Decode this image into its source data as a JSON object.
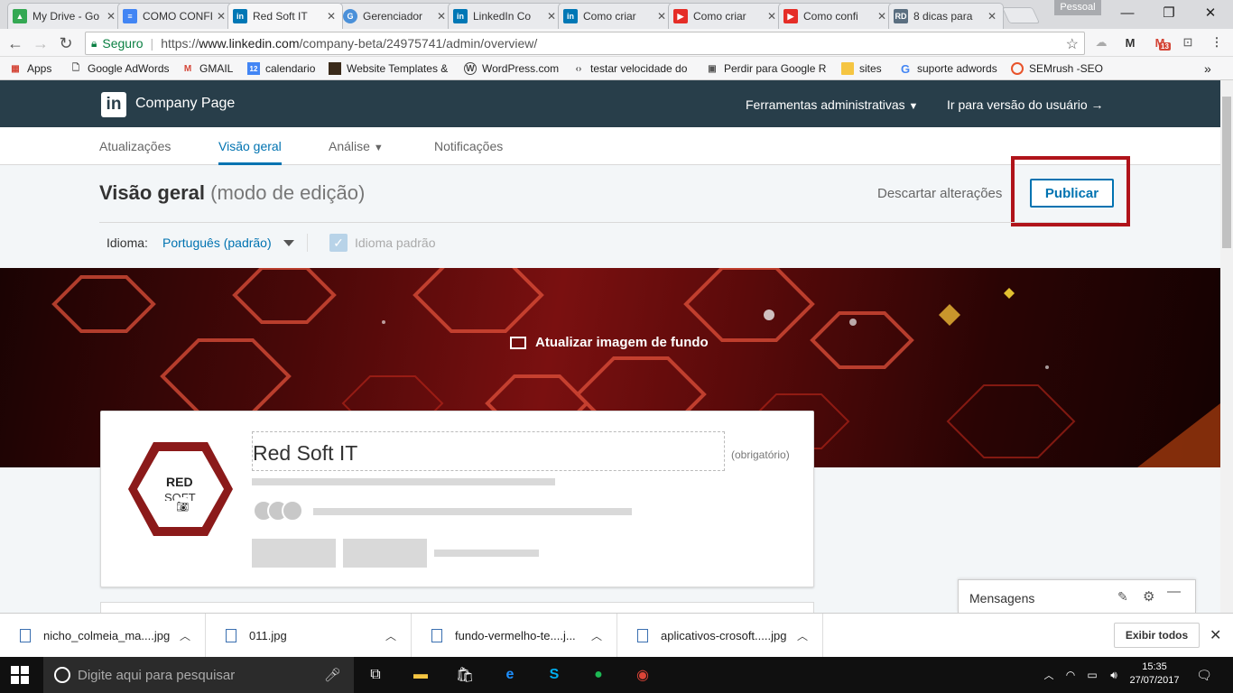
{
  "browser": {
    "tabs": [
      {
        "title": "My Drive - Go",
        "favicon": "google-drive-icon",
        "color": "#34a853"
      },
      {
        "title": "COMO CONFI",
        "favicon": "google-docs-icon",
        "color": "#4285f4"
      },
      {
        "title": "Red Soft IT",
        "favicon": "linkedin-icon",
        "color": "#0077b5",
        "active": true
      },
      {
        "title": "Gerenciador",
        "favicon": "gerenciador-icon",
        "color": "#4a90d9"
      },
      {
        "title": "LinkedIn Co",
        "favicon": "linkedin-icon",
        "color": "#0077b5"
      },
      {
        "title": "Como criar",
        "favicon": "linkedin-icon",
        "color": "#0077b5"
      },
      {
        "title": "Como criar",
        "favicon": "youtube-icon",
        "color": "#e52d27"
      },
      {
        "title": "Como confi",
        "favicon": "youtube-icon",
        "color": "#e52d27"
      },
      {
        "title": "8 dicas para",
        "favicon": "rd-icon",
        "color": "#5a6e80"
      }
    ],
    "profile": "Pessoal",
    "secure_label": "Seguro",
    "url_prefix": "https://",
    "url_host": "www.linkedin.com",
    "url_path": "/company-beta/24975741/admin/overview/",
    "gmail_badge": "13",
    "bookmarks": [
      {
        "label": "Apps"
      },
      {
        "label": "Google AdWords"
      },
      {
        "label": "GMAIL"
      },
      {
        "label": "calendario"
      },
      {
        "label": "Website Templates &"
      },
      {
        "label": "WordPress.com"
      },
      {
        "label": "testar velocidade do"
      },
      {
        "label": "Perdir para Google R"
      },
      {
        "label": "sites"
      },
      {
        "label": "suporte adwords"
      },
      {
        "label": "SEMrush -SEO"
      }
    ]
  },
  "linkedin": {
    "logo_text": "in",
    "header_title": "Company Page",
    "admin_tools": "Ferramentas administrativas",
    "user_view": "Ir para versão do usuário",
    "subnav": [
      "Atualizações",
      "Visão geral",
      "Análise",
      "Notificações"
    ],
    "page_title": "Visão geral",
    "page_mode": "(modo de edição)",
    "discard": "Descartar alterações",
    "publish": "Publicar",
    "language_label": "Idioma:",
    "language_value": "Português (padrão)",
    "default_language": "Idioma padrão",
    "banner_action": "Atualizar imagem de fundo",
    "company_name": "Red Soft IT",
    "required": "(obrigatório)",
    "logo_line1": "RED",
    "logo_line2": "SOFT",
    "messages": "Mensagens"
  },
  "downloads": {
    "files": [
      "nicho_colmeia_ma....jpg",
      "011.jpg",
      "fundo-vermelho-te....j...",
      "aplicativos-crosoft.....jpg"
    ],
    "show_all": "Exibir todos"
  },
  "taskbar": {
    "search_placeholder": "Digite aqui para pesquisar",
    "time": "15:35",
    "date": "27/07/2017"
  }
}
